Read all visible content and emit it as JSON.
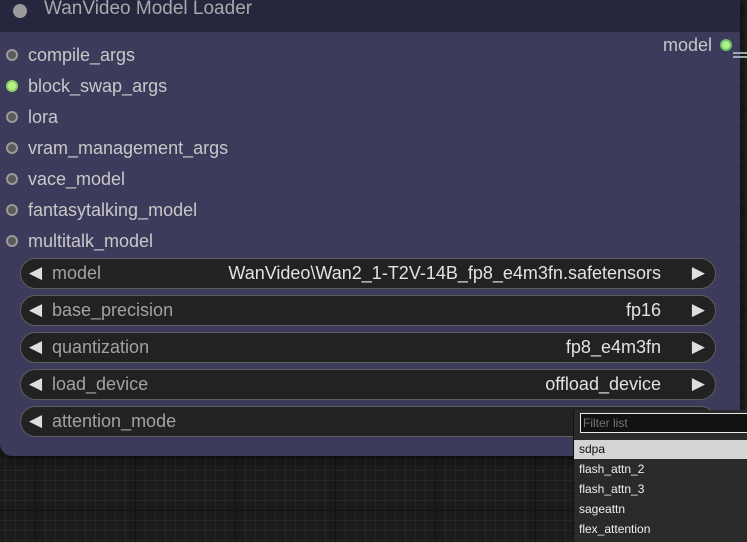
{
  "node": {
    "title": "WanVideo Model Loader",
    "inputs": [
      {
        "name": "compile_args",
        "connected": false
      },
      {
        "name": "block_swap_args",
        "connected": true
      },
      {
        "name": "lora",
        "connected": false
      },
      {
        "name": "vram_management_args",
        "connected": false
      },
      {
        "name": "vace_model",
        "connected": false
      },
      {
        "name": "fantasytalking_model",
        "connected": false
      },
      {
        "name": "multitalk_model",
        "connected": false
      }
    ],
    "output": {
      "name": "model",
      "connected": true
    },
    "widgets": [
      {
        "label": "model",
        "value": "WanVideo\\Wan2_1-T2V-14B_fp8_e4m3fn.safetensors"
      },
      {
        "label": "base_precision",
        "value": "fp16"
      },
      {
        "label": "quantization",
        "value": "fp8_e4m3fn"
      },
      {
        "label": "load_device",
        "value": "offload_device"
      },
      {
        "label": "attention_mode",
        "value": ""
      }
    ],
    "arrow_left": "◀",
    "arrow_right": "▶"
  },
  "dropdown": {
    "filter_placeholder": "Filter list",
    "options": [
      "sdpa",
      "flash_attn_2",
      "flash_attn_3",
      "sageattn",
      "flex_attention"
    ],
    "selected": "sdpa"
  },
  "colors": {
    "node_body": "#3d3b5c",
    "node_title": "#27263f",
    "connected_slot": "#b8f088",
    "canvas": "#1b1b1b"
  }
}
